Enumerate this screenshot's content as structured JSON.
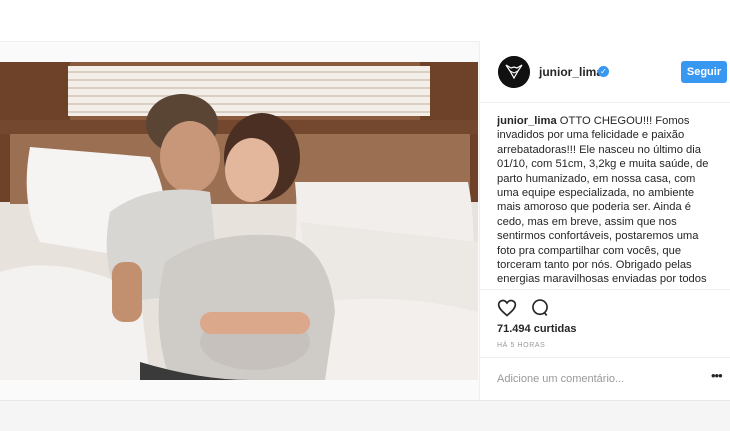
{
  "post": {
    "username": "junior_lima",
    "follow_label": "Seguir",
    "caption_user": "junior_lima",
    "caption_text": " OTTO CHEGOU!!! Fomos invadidos por uma felicidade e paixão arrebatadoras!!! Ele nasceu no último dia 01/10, com 51cm, 3,2kg e muita saúde, de parto humanizado, em nossa casa, com uma equipe especializada, no ambiente mais amoroso que poderia ser. Ainda é cedo, mas em breve, assim que nos sentirmos confortáveis, postaremos uma foto pra compartilhar com vocês, que torceram tanto por nós. Obrigado pelas energias maravilhosas enviadas por todos que acompanharam esse momento",
    "likes": "71.494 curtidas",
    "time": "HÁ 5 HORAS",
    "comment_placeholder": "Adicione um comentário...",
    "more_label": "•••"
  },
  "icons": {
    "like": "heart-icon",
    "comment": "comment-icon",
    "verified": "verified-badge-icon",
    "more": "more-options-icon"
  },
  "colors": {
    "accent": "#3897f0",
    "text": "#262626",
    "muted": "#999999",
    "border": "#efefef"
  }
}
